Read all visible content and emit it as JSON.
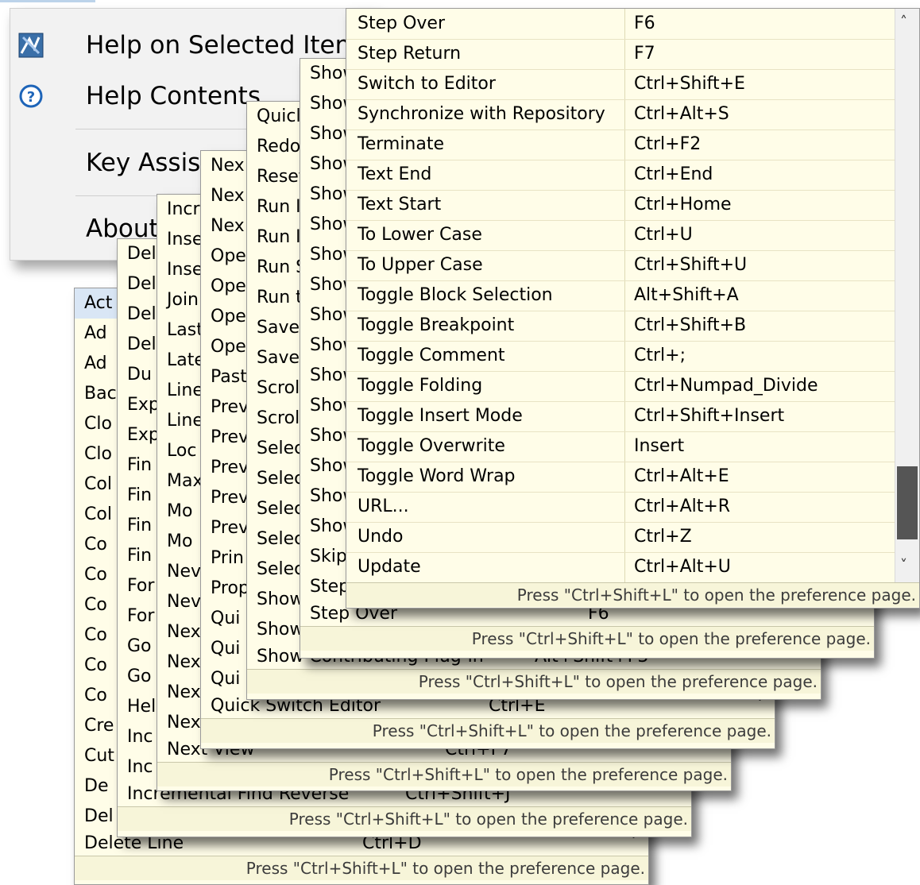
{
  "help_menu": {
    "items": [
      {
        "label": "Help on Selected Item",
        "icon": "help-selected-item-icon"
      },
      {
        "label": "Help Contents",
        "icon": "question-circle-icon"
      },
      {
        "label": "Key Assist...",
        "icon": ""
      },
      {
        "label": "About",
        "icon": ""
      }
    ]
  },
  "footer_text": "Press \"Ctrl+Shift+L\" to open the preference page.",
  "layers": {
    "l1": {
      "rows": [
        "Act",
        "Ad",
        "Ad",
        "Bac",
        "Clo",
        "Clo",
        "Col",
        "Col",
        "Co",
        "Co",
        "Co",
        "Co",
        "Co",
        "Co",
        "Cre",
        "Cut",
        "De",
        "Del"
      ],
      "last": {
        "cmd": "Delete Line",
        "key": "Ctrl+D"
      }
    },
    "l2": {
      "rows": [
        "Del",
        "Del",
        "Del",
        "Del",
        "Du",
        "Exp",
        "Exp",
        "Fin",
        "Fin",
        "Fin",
        "Fin",
        "For",
        "For",
        "Go",
        "Go",
        "Hel",
        "Inc",
        "Inc"
      ],
      "last": {
        "cmd": "Incremental Find Reverse",
        "key": "Ctrl+Shift+J"
      }
    },
    "l3": {
      "rows": [
        "Incr",
        "Inse",
        "Inse",
        "Join",
        "Last",
        "Late",
        "Line",
        "Line",
        "Loc",
        "Max",
        "Mo",
        "Mo",
        "Nev",
        "Nev",
        "Nex",
        "Nex",
        "Nex",
        "Nex"
      ],
      "last": {
        "cmd": "Next View",
        "key": "Ctrl+F7"
      }
    },
    "l4": {
      "rows": [
        "Nex",
        "Nex",
        "Nex",
        "Ope",
        "Ope",
        "Ope",
        "Ope",
        "Past",
        "Prev",
        "Prev",
        "Prev",
        "Prev",
        "Prev",
        "Prin",
        "Prop",
        "Qui",
        "Qui",
        "Qui"
      ],
      "last": {
        "cmd": "Quick Switch Editor",
        "key": "Ctrl+E"
      }
    },
    "l5": {
      "rows": [
        "Quicl",
        "Redo",
        "Reset",
        "Run I",
        "Run I",
        "Run S",
        "Run t",
        "Save",
        "Save",
        "Scrol",
        "Scrol",
        "Selec",
        "Selec",
        "Selec",
        "Selec",
        "Selec",
        "Show",
        "Show"
      ],
      "last": {
        "cmd": "Show Contributing Plug-in",
        "key": "Alt+Shift+F3"
      }
    },
    "l6": {
      "rows": [
        "Show",
        "Show",
        "Show",
        "Show",
        "Show",
        "Show",
        "Show",
        "Show",
        "Show",
        "Show",
        "Show",
        "Show",
        "Show",
        "Show",
        "Show",
        "Show",
        "Skip",
        "Step"
      ],
      "last": {
        "cmd": "Step Over",
        "key": "F6"
      }
    }
  },
  "shortcuts": [
    {
      "cmd": "Step Over",
      "key": "F6"
    },
    {
      "cmd": "Step Return",
      "key": "F7"
    },
    {
      "cmd": "Switch to Editor",
      "key": "Ctrl+Shift+E"
    },
    {
      "cmd": "Synchronize with Repository",
      "key": "Ctrl+Alt+S"
    },
    {
      "cmd": "Terminate",
      "key": "Ctrl+F2"
    },
    {
      "cmd": "Text End",
      "key": "Ctrl+End"
    },
    {
      "cmd": "Text Start",
      "key": "Ctrl+Home"
    },
    {
      "cmd": "To Lower Case",
      "key": "Ctrl+U"
    },
    {
      "cmd": "To Upper Case",
      "key": "Ctrl+Shift+U"
    },
    {
      "cmd": "Toggle Block Selection",
      "key": "Alt+Shift+A"
    },
    {
      "cmd": "Toggle Breakpoint",
      "key": "Ctrl+Shift+B"
    },
    {
      "cmd": "Toggle Comment",
      "key": "Ctrl+;"
    },
    {
      "cmd": "Toggle Folding",
      "key": "Ctrl+Numpad_Divide"
    },
    {
      "cmd": "Toggle Insert Mode",
      "key": "Ctrl+Shift+Insert"
    },
    {
      "cmd": "Toggle Overwrite",
      "key": "Insert"
    },
    {
      "cmd": "Toggle Word Wrap",
      "key": "Ctrl+Alt+E"
    },
    {
      "cmd": "URL...",
      "key": "Ctrl+Alt+R"
    },
    {
      "cmd": "Undo",
      "key": "Ctrl+Z"
    },
    {
      "cmd": "Update",
      "key": "Ctrl+Alt+U"
    }
  ],
  "scrollbar": {
    "up_glyph": "˄",
    "down_glyph": "˅"
  }
}
